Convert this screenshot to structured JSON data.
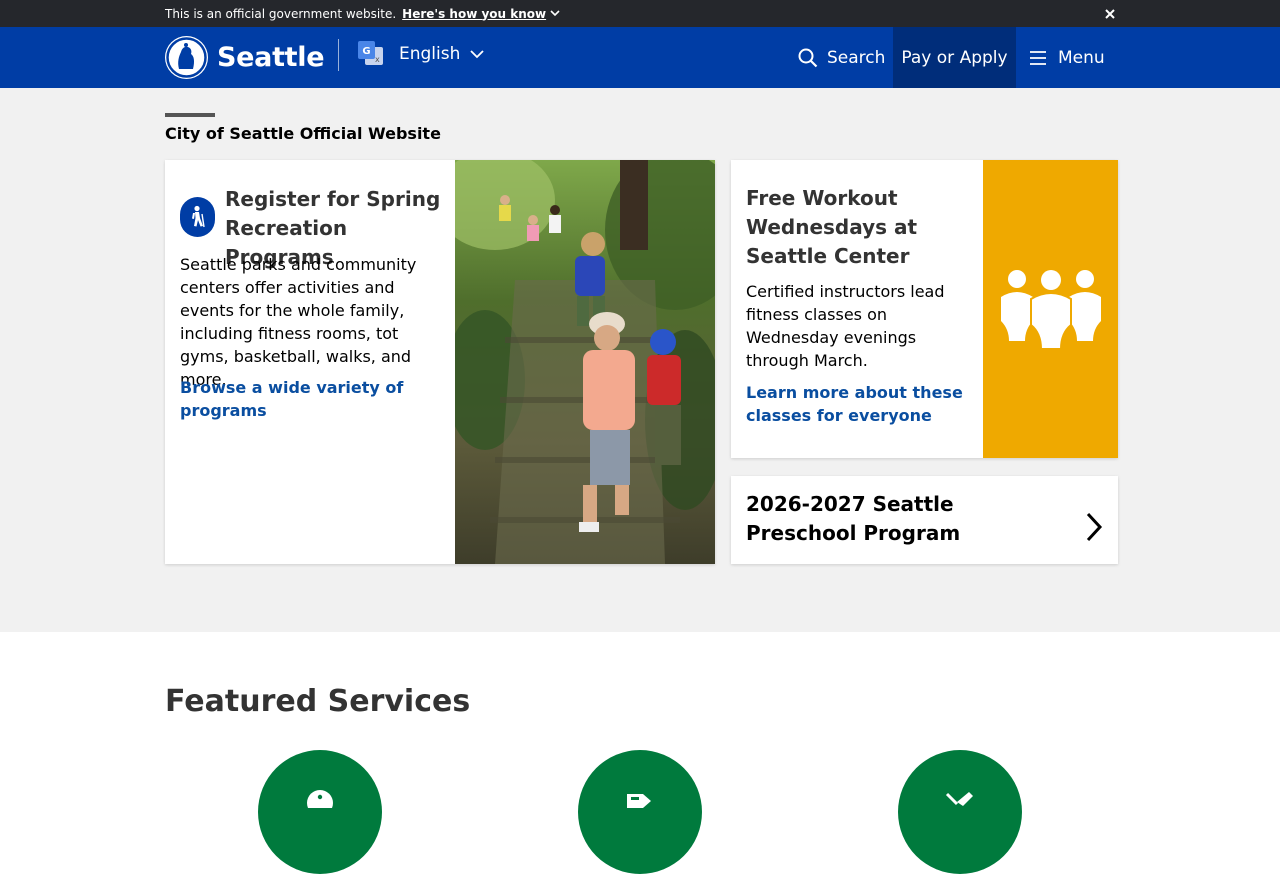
{
  "gov_banner": {
    "text": "This is an official government website.",
    "link": "Here's how you know"
  },
  "header": {
    "logo_text": "Seattle",
    "language": "English",
    "search_label": "Search",
    "pay_label": "Pay or Apply",
    "menu_label": "Menu"
  },
  "hero": {
    "eyebrow": "City of Seattle Official Website",
    "card_main": {
      "title": "Register for Spring Recreation Programs",
      "body": "Seattle parks and community centers offer activities and events for the whole family, including fitness rooms, tot gyms, basketball, walks, and more.",
      "link": "Browse a wide variety of programs",
      "icon": "hiking-icon"
    },
    "card_side": {
      "title": "Free Workout Wednesdays at Seattle Center",
      "body": "Certified instructors lead fitness classes on Wednesday evenings through March.",
      "link": "Learn more about these classes for everyone",
      "icon": "group-people-icon",
      "accent": "#efa900"
    },
    "card_link": {
      "title": "2026-2027 Seattle Preschool Program"
    }
  },
  "featured": {
    "title": "Featured Services",
    "accent": "#007a3d",
    "items": [
      {
        "icon": "info-icon"
      },
      {
        "icon": "ticket-icon"
      },
      {
        "icon": "tool-icon"
      }
    ]
  },
  "colors": {
    "brand_blue": "#003da5",
    "pay_blue": "#002d7a",
    "link_blue": "#0a4ea0",
    "banner_dark": "#25272c"
  }
}
